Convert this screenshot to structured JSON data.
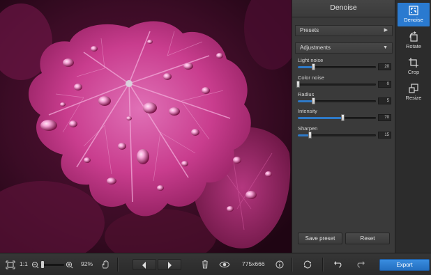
{
  "panel": {
    "title": "Denoise",
    "presets_label": "Presets",
    "adjustments_label": "Adjustments",
    "sliders": [
      {
        "label": "Light noise",
        "value": "20",
        "fraction": 0.2
      },
      {
        "label": "Color noise",
        "value": "0",
        "fraction": 0.0
      },
      {
        "label": "Radius",
        "value": "5",
        "fraction": 0.2
      },
      {
        "label": "Intensity",
        "value": "70",
        "fraction": 0.57
      },
      {
        "label": "Sharpen",
        "value": "15",
        "fraction": 0.15
      }
    ],
    "save_preset_label": "Save preset",
    "reset_label": "Reset"
  },
  "tools": {
    "items": [
      {
        "label": "Denoise",
        "icon": "denoise-icon",
        "active": true
      },
      {
        "label": "Rotate",
        "icon": "rotate-icon",
        "active": false
      },
      {
        "label": "Crop",
        "icon": "crop-icon",
        "active": false
      },
      {
        "label": "Resize",
        "icon": "resize-icon",
        "active": false
      }
    ]
  },
  "bottombar": {
    "actual_size_label": "1:1",
    "zoom_percent": "92%",
    "zoom_fraction": 0.1,
    "image_size": "775x666",
    "export_label": "Export"
  },
  "colors": {
    "accent": "#2a7ad0",
    "panel_bg": "#3a3a3a",
    "photo_main": "#c0307e"
  }
}
